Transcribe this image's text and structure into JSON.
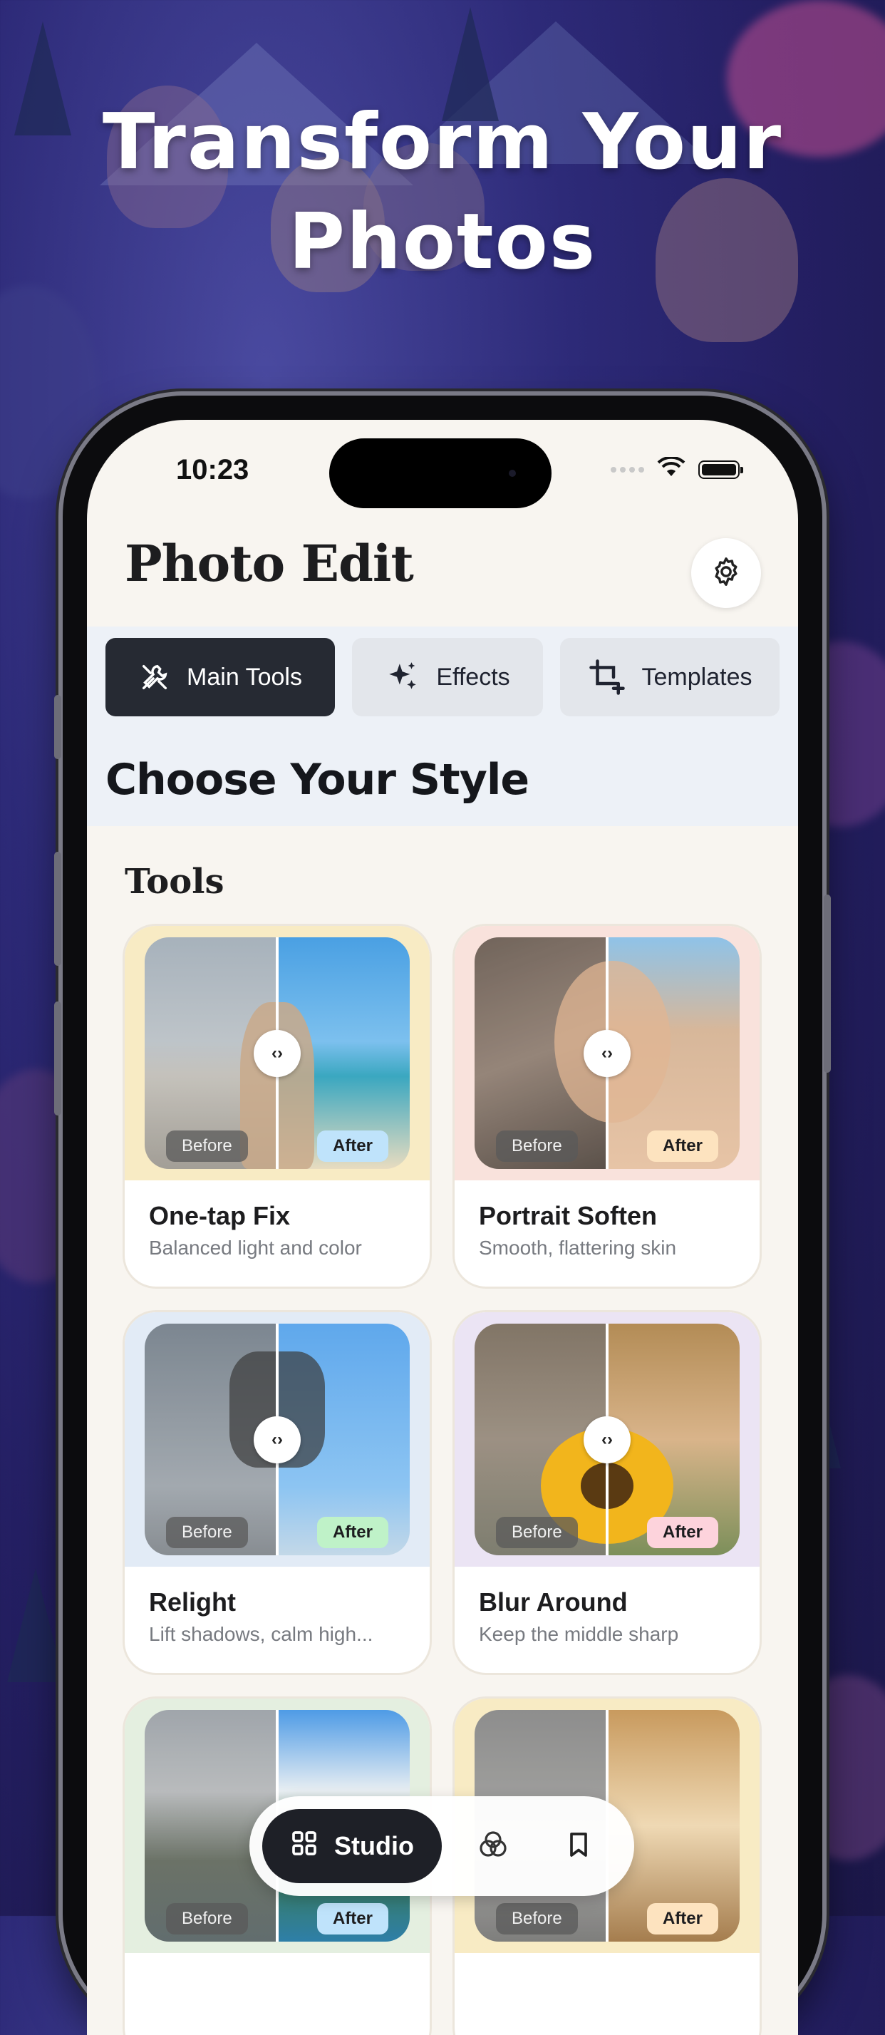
{
  "headline": {
    "line1": "Transform Your",
    "line2": "Photos"
  },
  "status_bar": {
    "time": "10:23"
  },
  "app": {
    "title": "Photo Edit"
  },
  "tabs": [
    {
      "label": "Main Tools",
      "icon": "tools-icon",
      "active": true
    },
    {
      "label": "Effects",
      "icon": "sparkles-icon",
      "active": false
    },
    {
      "label": "Templates",
      "icon": "crop-add-icon",
      "active": false
    }
  ],
  "hero": {
    "heading": "Choose Your Style"
  },
  "tools_section": {
    "title": "Tools"
  },
  "cards": [
    {
      "name": "One-tap Fix",
      "description": "Balanced light and color",
      "before_label": "Before",
      "after_label": "After",
      "frame_color": "#f8ebc4",
      "after_color": "#bfe3fb"
    },
    {
      "name": "Portrait Soften",
      "description": "Smooth, flattering skin",
      "before_label": "Before",
      "after_label": "After",
      "frame_color": "#f9e2dc",
      "after_color": "#fde3bf"
    },
    {
      "name": "Relight",
      "description": "Lift shadows, calm high...",
      "before_label": "Before",
      "after_label": "After",
      "frame_color": "#e2ebf6",
      "after_color": "#bff2c8"
    },
    {
      "name": "Blur Around",
      "description": "Keep the middle sharp",
      "before_label": "Before",
      "after_label": "After",
      "frame_color": "#ebe4f4",
      "after_color": "#fdd3dc"
    },
    {
      "name": "",
      "description": "",
      "before_label": "Before",
      "after_label": "After",
      "frame_color": "#e4efe0",
      "after_color": "#bfe3fb"
    },
    {
      "name": "",
      "description": "",
      "before_label": "Before",
      "after_label": "After",
      "frame_color": "#f8ebc4",
      "after_color": "#fde3bf"
    }
  ],
  "bottom_nav": {
    "studio_label": "Studio"
  }
}
